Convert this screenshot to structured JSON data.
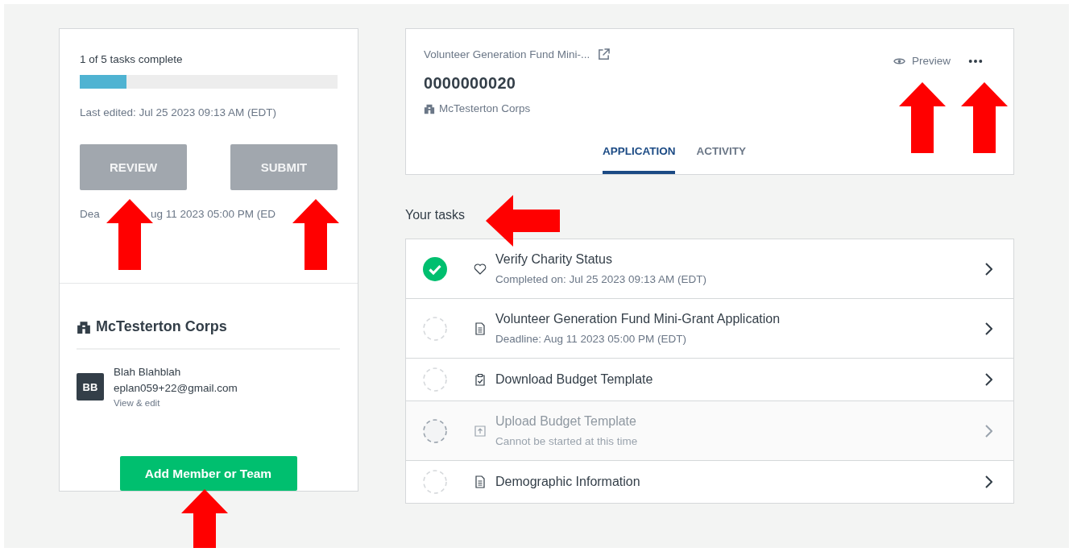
{
  "progress": {
    "label": "1 of 5 tasks complete",
    "level": 0.18
  },
  "last_edited": "Last edited: Jul 25 2023 09:13 AM (EDT)",
  "actions": [
    {
      "label": "REVIEW",
      "disabled": true
    },
    {
      "label": "SUBMIT",
      "disabled": true
    }
  ],
  "deadline": [
    "Dea",
    "ug 11 2023 05:00 PM (ED"
  ],
  "organization": {
    "name": "McTesterton Corps"
  },
  "member": {
    "initials": "BB",
    "name": "Blah Blahblah",
    "email": "eplan059+22@gmail.com",
    "link": "View & edit"
  },
  "add_button": "Add Member or Team",
  "application": {
    "title": "Volunteer Generation Fund Mini-...",
    "number": "0000000020",
    "organization": "McTesterton Corps",
    "preview": "Preview"
  },
  "tabs": [
    {
      "label": "APPLICATION",
      "selected": true
    },
    {
      "label": "ACTIVITY",
      "selected": false
    }
  ],
  "tasks_heading": "Your tasks",
  "tasks": [
    {
      "title": "Verify Charity Status",
      "subtitle": "Completed on: Jul 25 2023 09:13 AM (EDT)",
      "kind": "heart",
      "completed": true,
      "disabled": false
    },
    {
      "title": "Volunteer Generation Fund Mini-Grant Application",
      "subtitle": "Deadline: Aug 11 2023 05:00 PM (EDT)",
      "kind": "document",
      "completed": false,
      "disabled": false
    },
    {
      "title": "Download Budget Template",
      "kind": "clipboard",
      "completed": false,
      "disabled": false
    },
    {
      "title": "Upload Budget Template",
      "subtitle": "Cannot be started at this time",
      "kind": "upload",
      "completed": false,
      "disabled": true
    },
    {
      "title": "Demographic Information",
      "kind": "document",
      "completed": false,
      "disabled": false
    }
  ]
}
